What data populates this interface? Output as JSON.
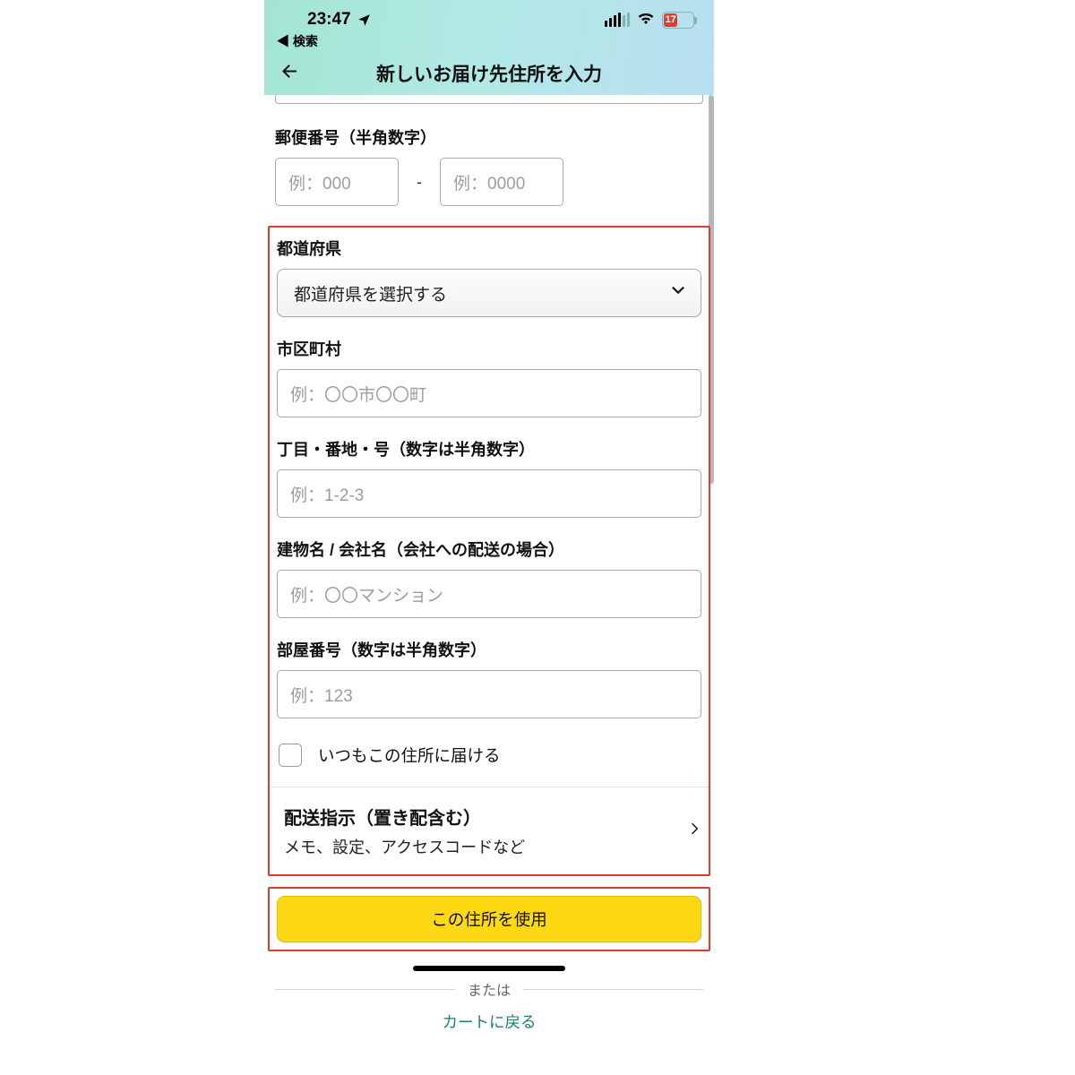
{
  "status": {
    "time": "23:47",
    "back_search": "◀ 検索",
    "battery": "17"
  },
  "header": {
    "title": "新しいお届け先住所を入力"
  },
  "postal": {
    "label": "郵便番号（半角数字）",
    "ph1": "例：000",
    "dash": "-",
    "ph2": "例：0000"
  },
  "pref": {
    "label": "都道府県",
    "select_text": "都道府県を選択する"
  },
  "city": {
    "label": "市区町村",
    "ph": "例：〇〇市〇〇町"
  },
  "street": {
    "label": "丁目・番地・号（数字は半角数字）",
    "ph": "例：1-2-3"
  },
  "building": {
    "label": "建物名 / 会社名（会社への配送の場合）",
    "ph": "例：〇〇マンション"
  },
  "room": {
    "label": "部屋番号（数字は半角数字）",
    "ph": "例：123"
  },
  "default_check": {
    "label": "いつもこの住所に届ける"
  },
  "delivery": {
    "title": "配送指示（置き配含む）",
    "sub": "メモ、設定、アクセスコードなど"
  },
  "actions": {
    "use_address": "この住所を使用",
    "or": "または",
    "back_to_cart": "カートに戻る"
  }
}
